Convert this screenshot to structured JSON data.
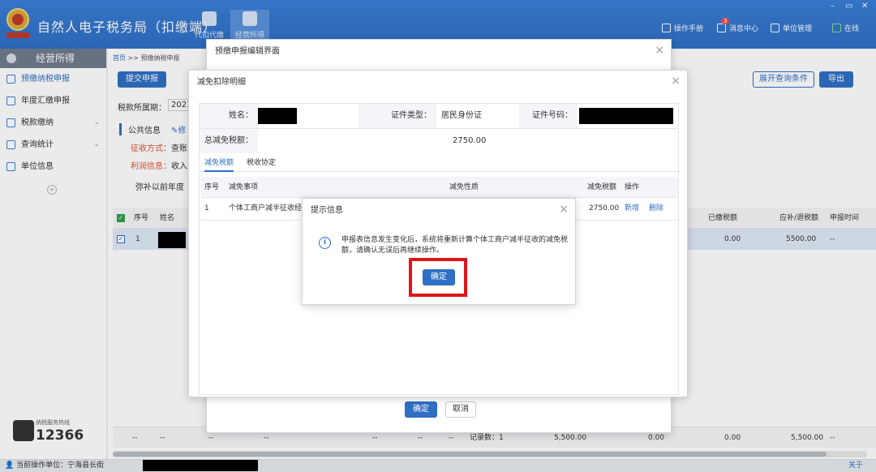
{
  "header": {
    "title": "自然人电子税务局（扣缴端）",
    "tabs": [
      {
        "label": "代扣代缴"
      },
      {
        "label": "经营所得"
      }
    ],
    "right": [
      {
        "label": "操作手册"
      },
      {
        "label": "消息中心",
        "badge": "3"
      },
      {
        "label": "单位管理"
      },
      {
        "label": "在线"
      }
    ],
    "window_controls": [
      "–",
      "▭",
      "✕"
    ]
  },
  "sidebar": {
    "heading": "经营所得",
    "items": [
      {
        "label": "预缴纳税申报",
        "active": true
      },
      {
        "label": "年度汇缴申报"
      },
      {
        "label": "税款缴纳",
        "chev": "⌄"
      },
      {
        "label": "查询统计",
        "chev": "⌄"
      },
      {
        "label": "单位信息"
      }
    ],
    "collapse": "«",
    "hotline_label": "纳税服务热线",
    "hotline": "12366"
  },
  "main": {
    "breadcrumb": {
      "home": "首页",
      "sep": ">>",
      "current": "预缴纳税申报"
    },
    "submit_btn": "提交申报",
    "expand_btn": "展开查询条件",
    "export_btn": "导出",
    "period_label": "税款所属期：",
    "period_value": "2023",
    "public_info": "公共信息",
    "edit": "修",
    "collect_method": "征收方式：",
    "collect_value": "查账",
    "profit_info": "利润信息：",
    "profit_value": "收入",
    "loss_text": "弥补以前年度",
    "grid_headers": [
      "序号",
      "姓名",
      "已缴税额",
      "应补/退税额",
      "申报时间"
    ],
    "grid_row": {
      "index": "1",
      "paid": "0.00",
      "refund": "5500.00",
      "time": "--"
    },
    "footer": {
      "dash1": "--",
      "dash2": "--",
      "dash3": "--",
      "dash4": "--",
      "dash5": "--",
      "dash6": "--",
      "dash7": "--",
      "count": "记录数：1",
      "total": "5,500.00",
      "v1": "0.00",
      "v2": "0.00",
      "v3": "5,500.00",
      "v4": "--"
    }
  },
  "status": {
    "unit_label": "当前操作单位：宁海县长街",
    "about": "关于"
  },
  "edit_dialog": {
    "title": "预缴申报编辑界面",
    "confirm": "确定",
    "cancel": "取消"
  },
  "exempt_dialog": {
    "title": "减免扣除明细",
    "name_label": "姓名：",
    "cert_type_label": "证件类型：",
    "cert_type_value": "居民身份证",
    "cert_no_label": "证件号码：",
    "total_label": "总减免税额：",
    "total_value": "2750.00",
    "tabs": [
      {
        "label": "减免税额",
        "active": true
      },
      {
        "label": "税收协定"
      }
    ],
    "columns": [
      "序号",
      "减免事项",
      "减免性质",
      "减免税额",
      "操作"
    ],
    "row": {
      "index": "1",
      "item": "个体工商户减半征收经",
      "amount": "2750.00",
      "add": "新增",
      "delete": "删除"
    }
  },
  "prompt_dialog": {
    "title": "提示信息",
    "message": "申报表信息发生变化后，系统将重新计算个体工商户减半征收的减免税额，请确认无误后再继续操作。",
    "confirm": "确定"
  },
  "colors": {
    "brand": "#2f6fc4",
    "highlight": "#e0141a"
  }
}
